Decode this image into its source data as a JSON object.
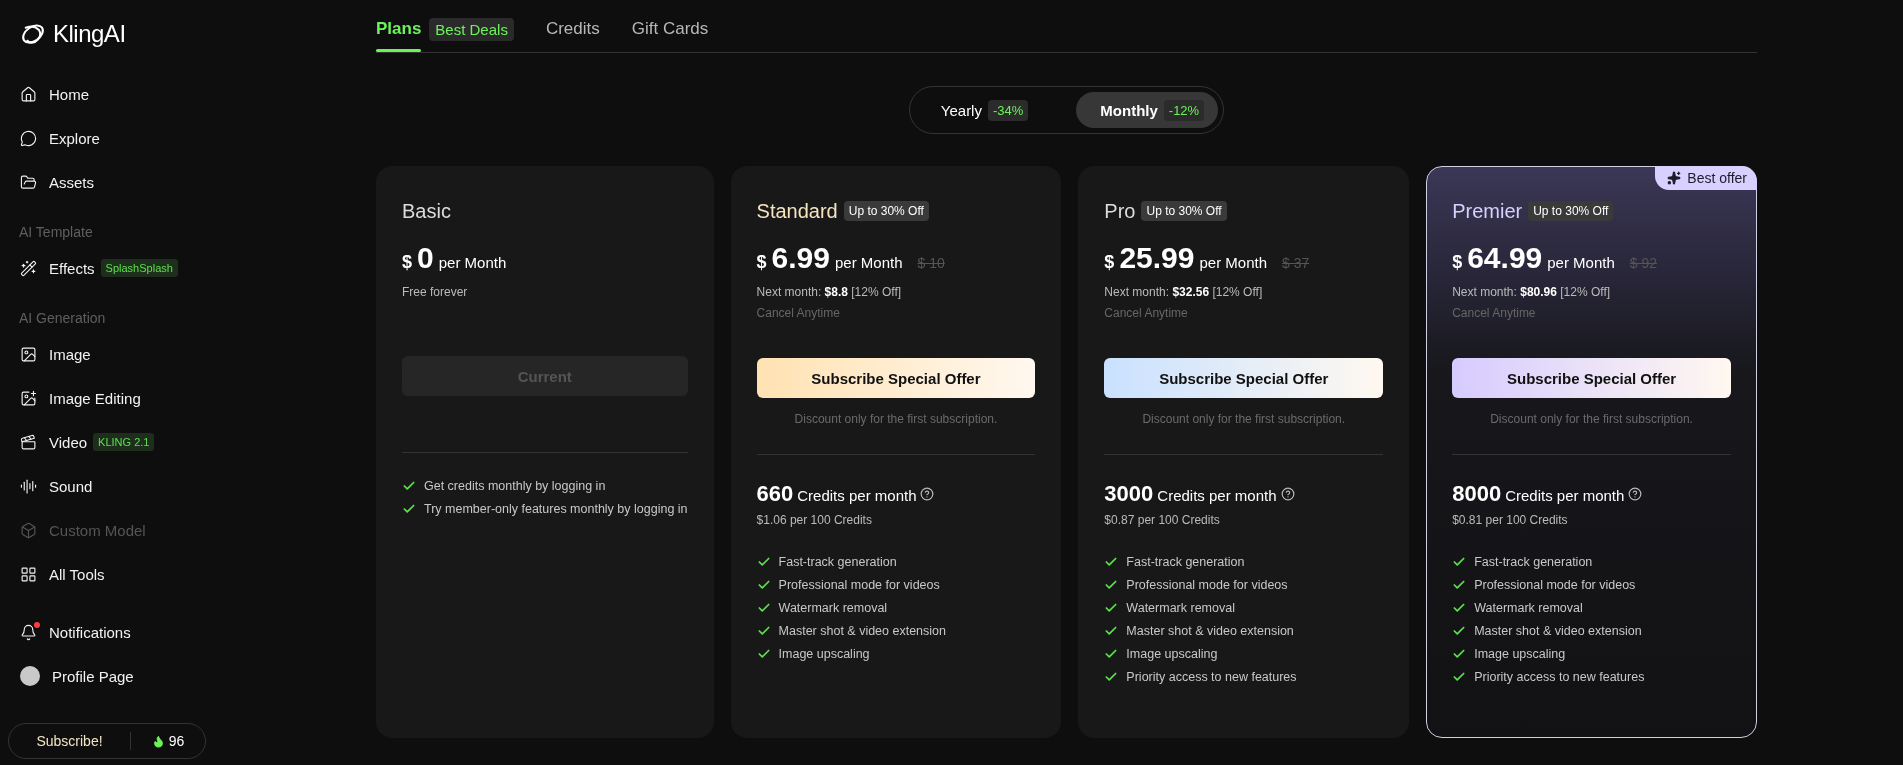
{
  "logo": {
    "text": "KlingAI"
  },
  "sidebar": {
    "groups": [
      {
        "items": [
          {
            "label": "Home",
            "disabled": false
          },
          {
            "label": "Explore",
            "disabled": false
          },
          {
            "label": "Assets",
            "disabled": false
          }
        ]
      },
      {
        "heading": "AI Template",
        "items": [
          {
            "label": "Effects",
            "tag": "SplashSplash",
            "disabled": false
          }
        ]
      },
      {
        "heading": "AI Generation",
        "items": [
          {
            "label": "Image",
            "disabled": false
          },
          {
            "label": "Image Editing",
            "disabled": false
          },
          {
            "label": "Video",
            "tag": "KLING 2.1",
            "disabled": false
          },
          {
            "label": "Sound",
            "disabled": false
          },
          {
            "label": "Custom Model",
            "disabled": true
          },
          {
            "label": "All Tools",
            "disabled": false
          }
        ]
      }
    ],
    "notifications": {
      "label": "Notifications",
      "unread": true
    },
    "profile": {
      "label": "Profile Page"
    },
    "subscribe": {
      "label": "Subscribe!",
      "credits": "96"
    }
  },
  "tabs": [
    {
      "label": "Plans",
      "badge": "Best Deals",
      "selected": true
    },
    {
      "label": "Credits",
      "selected": false
    },
    {
      "label": "Gift Cards",
      "selected": false
    }
  ],
  "billing_toggle": [
    {
      "label": "Yearly",
      "discount": "-34%",
      "selected": false
    },
    {
      "label": "Monthly",
      "discount": "-12%",
      "selected": true
    }
  ],
  "plans": [
    {
      "name": "Basic",
      "currency": "$",
      "price": "0",
      "period": "per Month",
      "note": "Free forever",
      "button": {
        "label": "Current",
        "kind": "current"
      },
      "features": [
        "Get credits monthly by logging in",
        "Try member-only features monthly by logging in"
      ],
      "highlighted": false
    },
    {
      "name": "Standard",
      "tag": "Up to 30% Off",
      "currency": "$",
      "price": "6.99",
      "period": "per Month",
      "old_price": "$ 10",
      "next_month": "Next month: **$8.8** [12% Off]",
      "cancel": "Cancel Anytime",
      "button": {
        "label": "Subscribe Special Offer",
        "kind": "offer"
      },
      "color": "#ffe2b2",
      "button_note": "Discount only for the first subscription.",
      "credits": "660",
      "credits_label": "Credits per month",
      "credit_rate": "$1.06 per 100 Credits",
      "features": [
        "Fast-track generation",
        "Professional mode for videos",
        "Watermark removal",
        "Master shot & video extension",
        "Image upscaling"
      ],
      "highlighted": false
    },
    {
      "name": "Pro",
      "tag": "Up to 30% Off",
      "currency": "$",
      "price": "25.99",
      "period": "per Month",
      "old_price": "$ 37",
      "next_month": "Next month: **$32.56** [12% Off]",
      "cancel": "Cancel Anytime",
      "button": {
        "label": "Subscribe Special Offer",
        "kind": "offer"
      },
      "color": "#c9e1ff",
      "button_note": "Discount only for the first subscription.",
      "credits": "3000",
      "credits_label": "Credits per month",
      "credit_rate": "$0.87 per 100 Credits",
      "features": [
        "Fast-track generation",
        "Professional mode for videos",
        "Watermark removal",
        "Master shot & video extension",
        "Image upscaling",
        "Priority access to new features"
      ],
      "highlighted": false
    },
    {
      "name": "Premier",
      "tag": "Up to 30% Off",
      "currency": "$",
      "price": "64.99",
      "period": "per Month",
      "old_price": "$ 92",
      "next_month": "Next month: **$80.96** [12% Off]",
      "cancel": "Cancel Anytime",
      "button": {
        "label": "Subscribe Special Offer",
        "kind": "offer"
      },
      "color": "#d6cbff",
      "button_note": "Discount only for the first subscription.",
      "credits": "8000",
      "credits_label": "Credits per month",
      "credit_rate": "$0.81 per 100 Credits",
      "features": [
        "Fast-track generation",
        "Professional mode for videos",
        "Watermark removal",
        "Master shot & video extension",
        "Image upscaling",
        "Priority access to new features"
      ],
      "highlighted": true,
      "badge": "Best offer"
    }
  ]
}
